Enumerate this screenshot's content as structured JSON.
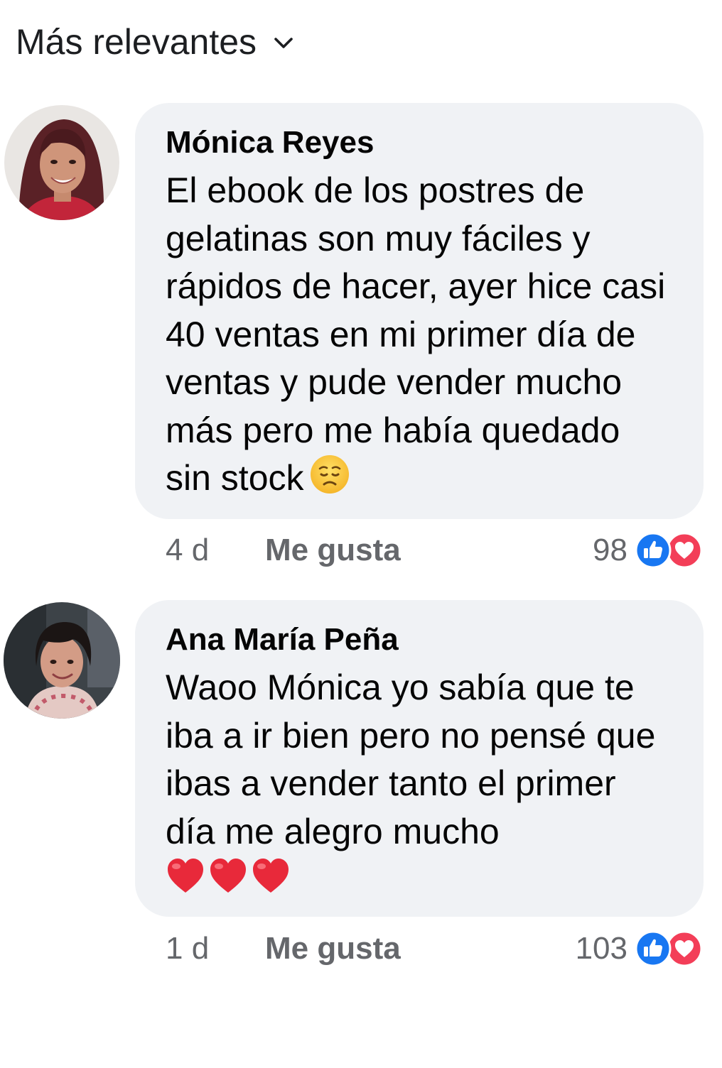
{
  "sort": {
    "label": "Más relevantes",
    "icon": "chevron-down-icon"
  },
  "comments": [
    {
      "author": "Mónica Reyes",
      "text": "El ebook de los postres de gelatinas son muy fáciles y rápidos de hacer, ayer hice casi 40 ventas en mi primer día de ventas y pude vender mucho más pero me había quedado sin stock",
      "emoji": "worried-face-emoji",
      "time": "4 d",
      "like_label": "Me gusta",
      "reaction_count": "98",
      "reactions": [
        "like-icon",
        "love-icon"
      ]
    },
    {
      "author": "Ana María Peña",
      "text": "Waoo Mónica yo sabía que te iba a ir bien pero no pensé que ibas a vender tanto el primer día me alegro mucho",
      "emoji": "heart-emoji",
      "time": "1 d",
      "like_label": "Me gusta",
      "reaction_count": "103",
      "reactions": [
        "like-icon",
        "love-icon"
      ]
    }
  ],
  "colors": {
    "bubble": "#f0f2f5",
    "meta_text": "#65676b",
    "like_blue": "#1877f2",
    "love_red": "#f33e58"
  }
}
